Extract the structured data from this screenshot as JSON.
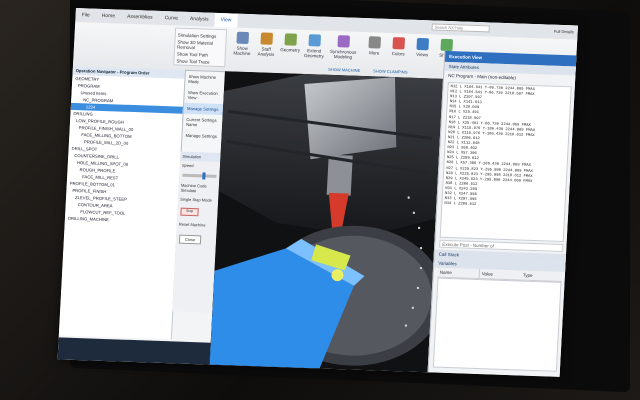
{
  "ribbon": {
    "tabs": [
      {
        "label": "File",
        "active": false
      },
      {
        "label": "Home",
        "active": false
      },
      {
        "label": "Assemblies",
        "active": false
      },
      {
        "label": "Curve",
        "active": false
      },
      {
        "label": "Analysis",
        "active": false
      },
      {
        "label": "View",
        "active": true
      }
    ],
    "simulation_settings": {
      "title": "Simulation Settings",
      "items": [
        "Show 3D Material Removal",
        "Show Tool Path",
        "Show Tool Trace"
      ]
    },
    "buttons": [
      "Show Machine",
      "Staff Analysis",
      "Geometry",
      "Extend Geometry",
      "Synchronous Modeling",
      "More",
      "Colors",
      "Views",
      "Sheets"
    ],
    "show_machine_label": "SHOW MACHINE",
    "show_clamping_label": "SHOW CLAMPING"
  },
  "search": {
    "placeholder": "Search NX Help"
  },
  "user_label": "Full Details",
  "navigator": {
    "title": "Operation Navigator - Program Order",
    "rows": [
      "GEOMETRY",
      "PROGRAM",
      "Unused Items",
      "NC_PROGRAM",
      "1234",
      "DRILLING",
      "LOW_PROFILE_ROUGH",
      "PROFILE_FINISH_WALL_00",
      "FACE_MILLING_BOTTOM",
      "PROFILE_MILL_2D_00",
      "DRILL_SPOT",
      "COUNTERSINK_DRILL",
      "HOLE_MILLING_SPOT_00",
      "ROUGH_PROFILE",
      "FACE_MILL_REST",
      "PROFILE_BOTTOM_01",
      "PROFILE_FINISH",
      "ZLEVEL_PROFILE_STEEP",
      "CONTOUR_AREA",
      "FLOWCUT_REF_TOOL",
      "DRILLING_MACHINE"
    ],
    "selected_index": 4
  },
  "context_menu": {
    "items": [
      "Show Machine Mode",
      "Show Execution View",
      "Manage Settings",
      "Current Settings Name",
      "Manage Settings"
    ],
    "highlighted_index": 2
  },
  "machine_panel": {
    "title": "Simulation",
    "speed_label": "Speed",
    "mode_label": "Machine Code Simulate",
    "single_step": "Single Step Mode",
    "reset_label": "Reset Machine",
    "stop_button": "Stop",
    "close_button": "Close"
  },
  "execution_view": {
    "title": "Execution View",
    "state_attributes": "State Attributes",
    "nc_program_label": "NC Program - Main (non-editable)",
    "nc_lines": [
      "N12 L X164.541 Y-86.739 2244.069 FMAX",
      "N12 L X164.541 Y-86.739 2218.597 FMAX",
      "N13 L Z207.597",
      "N14 L X141.613",
      "N15 L X28.049",
      "N16 L X25.491",
      "N17 L Z218.597",
      "N18 L X25.491 Y-86.739 2244.069 FMAX",
      "N19 L X115.976 Y-186.439 2244.069 FMAX",
      "N20 L X115.976 Y-186.439 2218.612 FMAX",
      "N21 L Z206.612",
      "N22 L X112.848",
      "N23 L X68.402",
      "N24 L X57.306",
      "N25 L Z209.612",
      "N26 L X57.306 Y-186.439 2244.069 FMAX",
      "N27 L X225.823 Y-295.098 2244.069 FMAX",
      "N28 L X225.823 Y-295.098 2218.612 FMAX",
      "N29 L X245.623 Y-295.098 2244.069 FMAX",
      "N30 L Z206.612",
      "N31 L X242.295",
      "N32 L X247.555",
      "N33 L X207.595",
      "N34 L Z209.612"
    ],
    "execute_placeholder": "Execute Post - Number of",
    "call_stack": "Call Stack",
    "variables": "Variables",
    "col_name": "Name",
    "col_value": "Value",
    "col_type": "Type"
  },
  "colors": {
    "accent": "#2f6fc0",
    "selection": "#3b8de0",
    "part_blue": "#2e8de8",
    "tool_red": "#d63a2a"
  }
}
